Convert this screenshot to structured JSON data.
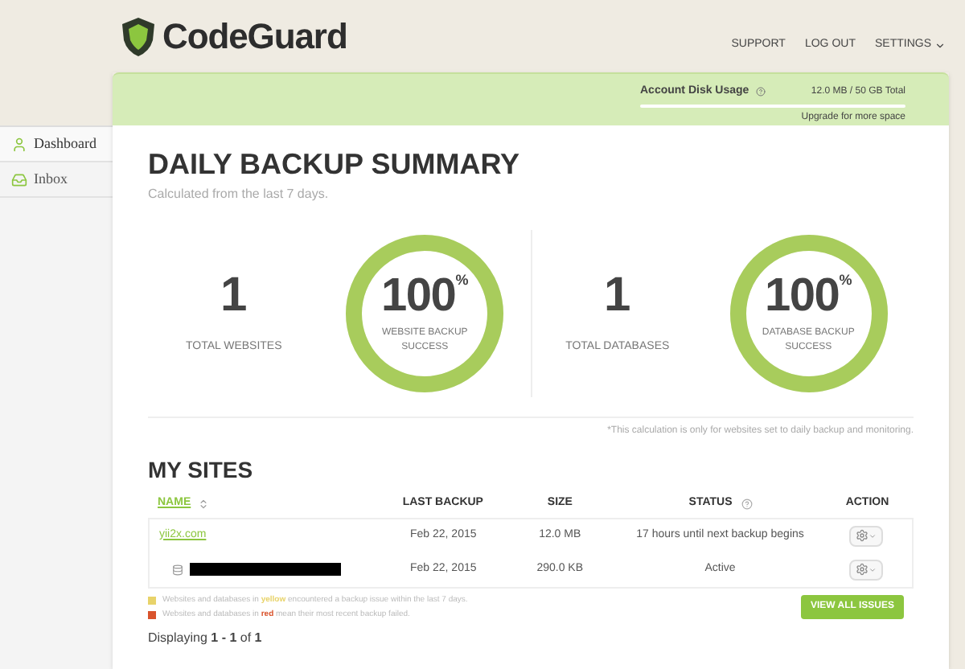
{
  "header": {
    "logo_text": "CodeGuard",
    "nav": [
      {
        "label": "SUPPORT",
        "dropdown": false
      },
      {
        "label": "LOG OUT",
        "dropdown": false
      },
      {
        "label": "SETTINGS",
        "dropdown": true
      }
    ]
  },
  "disk_usage": {
    "label": "Account Disk Usage",
    "reading": "12.0 MB / 50 GB Total",
    "level": 0,
    "link": "Upgrade for more space"
  },
  "sidebar": {
    "items": [
      {
        "label": "Dashboard",
        "kind": "user",
        "selected": true
      },
      {
        "label": "Inbox",
        "kind": "inbox",
        "selected": false
      }
    ]
  },
  "summary": {
    "title": "DAILY BACKUP SUMMARY",
    "subtitle": "Calculated from the last 7 days.",
    "groups": [
      {
        "count": "1",
        "count_label": "TOTAL WEBSITES",
        "percent": "100",
        "percent_sign": "%",
        "ring_label": "WEBSITE BACKUP SUCCESS",
        "level": 1
      },
      {
        "count": "1",
        "count_label": "TOTAL DATABASES",
        "percent": "100",
        "percent_sign": "%",
        "ring_label": "DATABASE BACKUP SUCCESS",
        "level": 1
      }
    ],
    "footnote": "*This calculation is only for websites set to daily backup and monitoring."
  },
  "sites": {
    "title": "MY SITES",
    "columns": [
      {
        "label": "NAME",
        "sortable": true,
        "help": false
      },
      {
        "label": "LAST BACKUP",
        "sortable": false,
        "help": false
      },
      {
        "label": "SIZE",
        "sortable": false,
        "help": false
      },
      {
        "label": "STATUS",
        "sortable": false,
        "help": true
      },
      {
        "label": "ACTION",
        "sortable": false,
        "help": false
      }
    ],
    "rows": [
      {
        "kind": "website",
        "name": "yii2x.com",
        "last_backup": "Feb 22, 2015",
        "size": "12.0 MB",
        "status": "17 hours until next backup begins"
      },
      {
        "kind": "database",
        "last_backup": "Feb 22, 2015",
        "size": "290.0 KB",
        "status": "Active"
      }
    ],
    "legend": [
      {
        "color": "#e8d36a",
        "before": "Websites and databases in ",
        "highlight": "yellow",
        "after": " encountered a backup issue within the last 7 days."
      },
      {
        "color": "#d9532c",
        "before": "Websites and databases in ",
        "highlight": "red",
        "after": " mean their most recent backup failed."
      }
    ],
    "button": "VIEW ALL ISSUES",
    "pagination": "Displaying **1 - 1** of **1**"
  }
}
